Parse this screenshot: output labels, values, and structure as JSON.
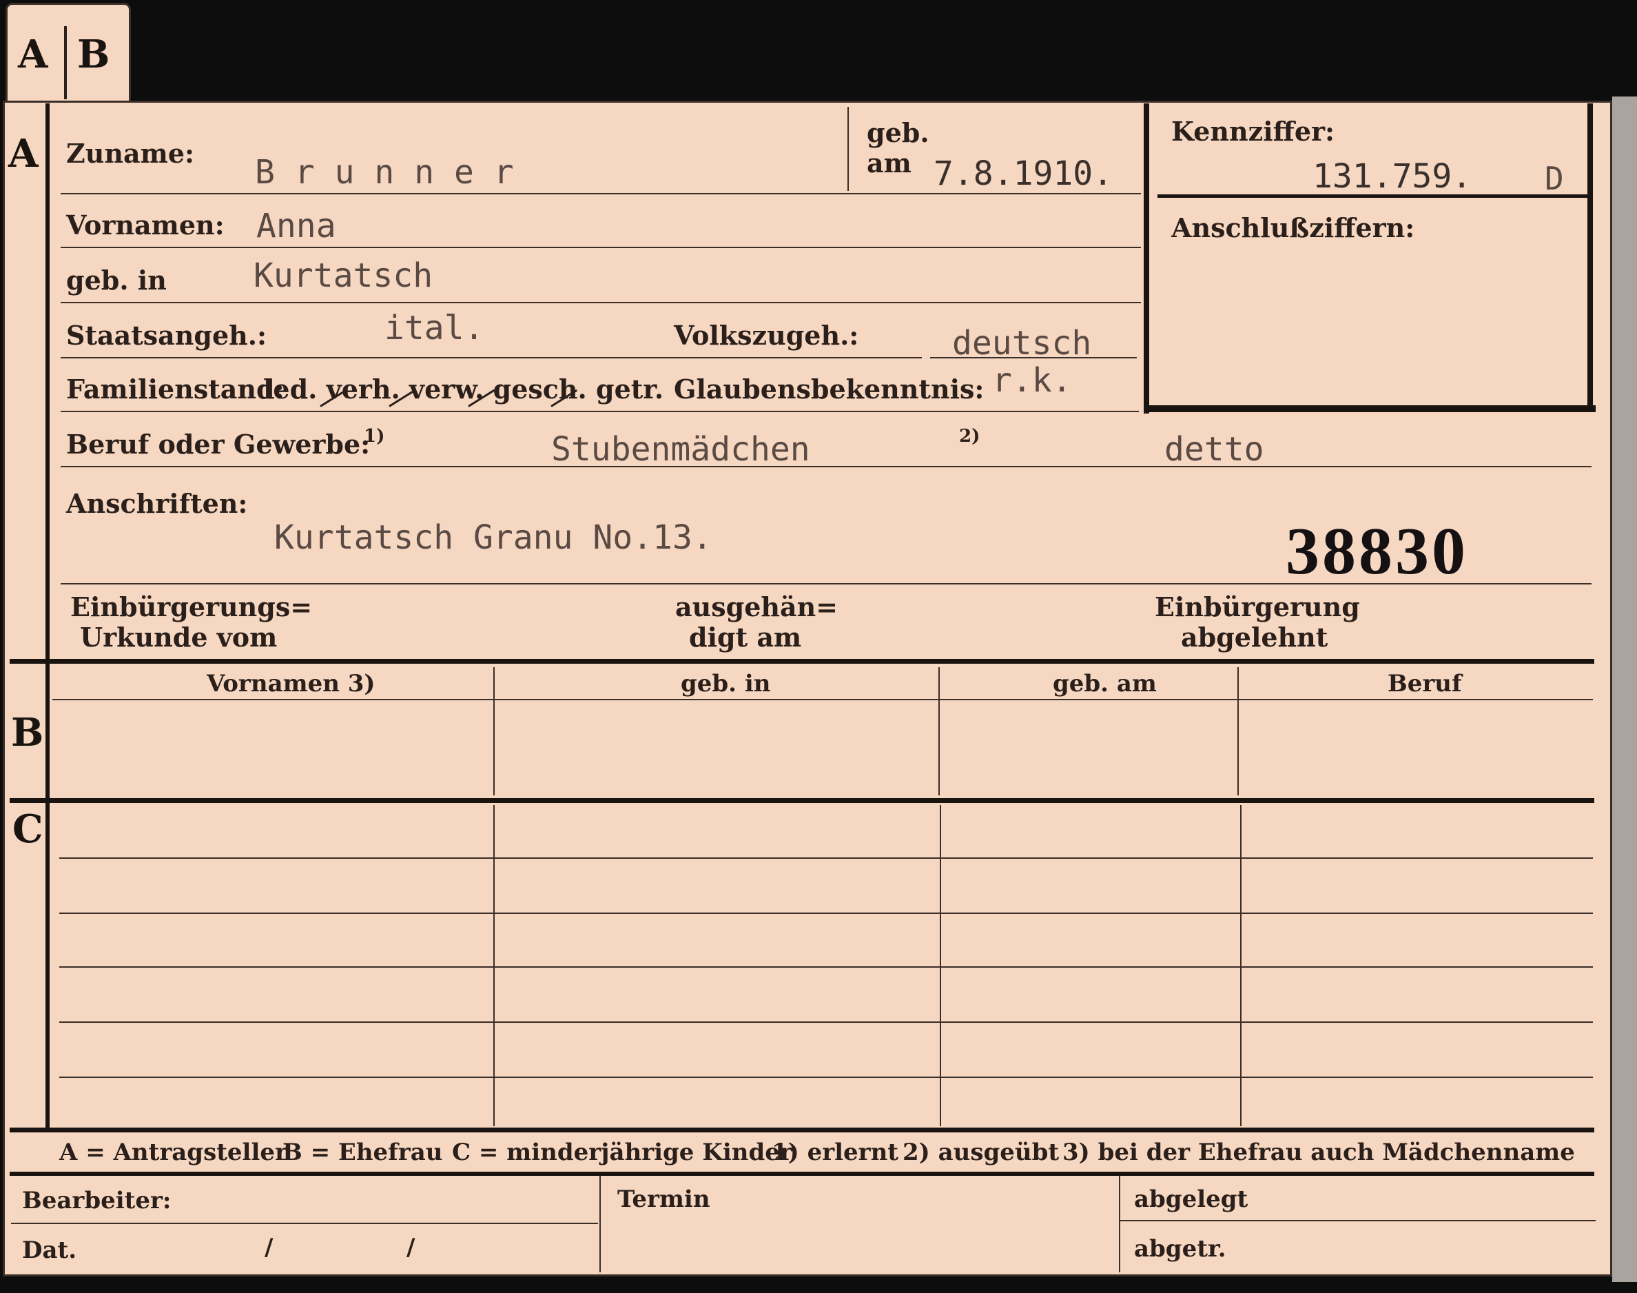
{
  "tab": {
    "letter_a": "A",
    "letter_b": "B"
  },
  "sections": {
    "a": "A",
    "b": "B",
    "c": "C"
  },
  "fields": {
    "zuname_label": "Zuname:",
    "zuname_value": "B r u n n e r",
    "geb_am_label_1": "geb.",
    "geb_am_label_2": "am",
    "geb_am_value": "7.8.1910.",
    "kennziffer_label": "Kennziffer:",
    "kennziffer_value": "131.759.",
    "kennziffer_suffix": "D",
    "anschluss_label": "Anschlußziffern:",
    "vornamen_label": "Vornamen:",
    "vornamen_value": "Anna",
    "geb_in_label": "geb. in",
    "geb_in_value": "Kurtatsch",
    "staat_label": "Staatsangeh.:",
    "staat_value": "ital.",
    "volk_label": "Volkszugeh.:",
    "volk_value": "deutsch",
    "familienstand_label": "Familienstand:",
    "familienstand_options": "led. verh. verw. gesch. getr.",
    "glauben_label": "Glaubensbekenntnis:",
    "glauben_value": "r.k.",
    "beruf_label": "Beruf oder Gewerbe:",
    "beruf_note1": "1)",
    "beruf_value": "Stubenmädchen",
    "beruf_note2": "2)",
    "beruf_value2": "detto",
    "anschriften_label": "Anschriften:",
    "anschriften_value": "Kurtatsch Granu No.13.",
    "stamp_number": "38830",
    "einb_urkunde_1": "Einbürgerungs=",
    "einb_urkunde_2": "Urkunde vom",
    "ausgeh_1": "ausgehän=",
    "ausgeh_2": "digt am",
    "einb_abgelehnt_1": "Einbürgerung",
    "einb_abgelehnt_2": "abgelehnt"
  },
  "table_b": {
    "headers": [
      "Vornamen 3)",
      "geb. in",
      "geb. am",
      "Beruf"
    ]
  },
  "legend": {
    "a": "A = Antragsteller",
    "b": "B = Ehefrau",
    "c": "C = minderjährige Kinder",
    "n1": "1) erlernt",
    "n2": "2) ausgeübt",
    "n3": "3) bei der Ehefrau auch Mädchenname"
  },
  "footer": {
    "bearbeiter": "Bearbeiter:",
    "dat": "Dat.",
    "slash1": "/",
    "slash2": "/",
    "termin": "Termin",
    "abgelegt": "abgelegt",
    "abgetr": "abgetr."
  }
}
